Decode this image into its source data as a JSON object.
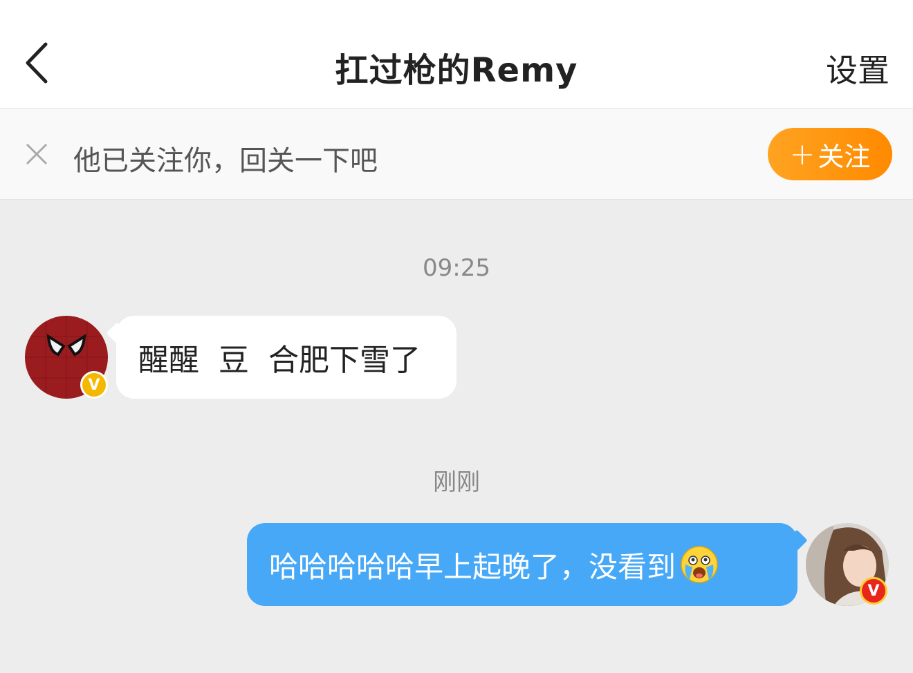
{
  "header": {
    "title": "扛过枪的Remy",
    "settings_label": "设置"
  },
  "follow_prompt": {
    "text": "他已关注你，回关一下吧",
    "button_label": "关注",
    "button_icon": "plus-icon"
  },
  "messages": [
    {
      "timestamp": "09:25",
      "sender": "other",
      "text": "醒醒  豆  合肥下雪了",
      "avatar_icon": "spiderman-mask-avatar",
      "badge": "V",
      "badge_color": "#f5b800"
    },
    {
      "timestamp": "刚刚",
      "sender": "self",
      "text": "哈哈哈哈哈早上起晚了，没看到",
      "emoji": "crying-laughing-emoji",
      "avatar_icon": "user-photo-avatar",
      "badge": "V",
      "badge_color": "#e8261c"
    }
  ],
  "colors": {
    "accent_orange": "#ff9a14",
    "self_bubble": "#47a8f7",
    "background": "#ededed"
  }
}
